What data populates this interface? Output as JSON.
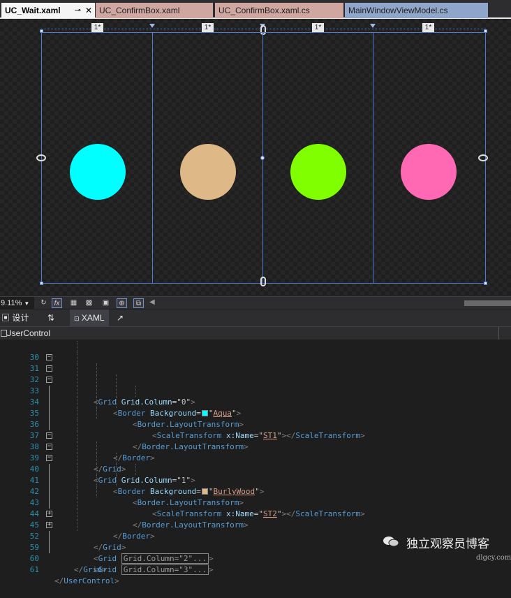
{
  "tabs": [
    {
      "label": "UC_Wait.xaml",
      "active": true,
      "pin": "⊸",
      "close": "✕"
    },
    {
      "label": "UC_ConfirmBox.xaml"
    },
    {
      "label": "UC_ConfirmBox.xaml.cs"
    },
    {
      "label": "MainWindowViewModel.cs"
    }
  ],
  "designer": {
    "column_headers": [
      "1*",
      "1*",
      "1*",
      "1*"
    ],
    "circle_colors": [
      "#00FFFF",
      "#DEB887",
      "#7FFF00",
      "#FF69B4"
    ]
  },
  "toolbar": {
    "zoom": "9.11%",
    "fx_label": "fx"
  },
  "split": {
    "design_label": "设计",
    "swap_label": "⇅",
    "xaml_label": "XAML"
  },
  "breadcrumb": {
    "label": "UserControl"
  },
  "editor": {
    "line_numbers": [
      "30",
      "31",
      "32",
      "33",
      "34",
      "35",
      "36",
      "37",
      "38",
      "39",
      "40",
      "41",
      "42",
      "43",
      "44",
      "45",
      "52",
      "59",
      "60",
      "61"
    ]
  },
  "code": {
    "l31_el": "Grid",
    "l31_attr": "Grid.Column",
    "l31_val": "0",
    "l32_el": "Border",
    "l32_attr": "Background",
    "l32_val": "Aqua",
    "l32_color": "#00FFFF",
    "l33_el": "Border.LayoutTransform",
    "l34_el": "ScaleTransform",
    "l34_attr": "x:Name",
    "l34_val": "ST1",
    "l34_close": "ScaleTransform",
    "l35_el": "Border.LayoutTransform",
    "l36_el": "Border",
    "l37_el": "Grid",
    "l38_el": "Grid",
    "l38_attr": "Grid.Column",
    "l38_val": "1",
    "l39_el": "Border",
    "l39_attr": "Background",
    "l39_val": "BurlyWood",
    "l39_color": "#DEB887",
    "l40_el": "Border.LayoutTransform",
    "l41_el": "ScaleTransform",
    "l41_attr": "x:Name",
    "l41_val": "ST2",
    "l41_close": "ScaleTransform",
    "l42_el": "Border.LayoutTransform",
    "l43_el": "Border",
    "l44_el": "Grid",
    "l45_el": "Grid",
    "l45_collapsed": "Grid.Column=\"2\"...",
    "l52_el": "Grid",
    "l52_collapsed": "Grid.Column=\"3\"...",
    "l59_el": "Grid",
    "l60_el": "UserControl"
  },
  "watermark": {
    "text": "独立观察员博客",
    "site": "dlgcy.com"
  }
}
